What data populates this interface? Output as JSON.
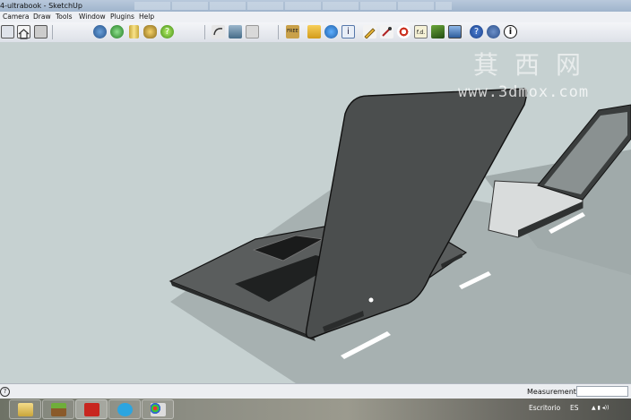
{
  "window": {
    "title": "4-ultrabook - SketchUp"
  },
  "menu": [
    {
      "label": "Camera"
    },
    {
      "label": "Draw"
    },
    {
      "label": "Tools"
    },
    {
      "label": "Window"
    },
    {
      "label": "Plugins"
    },
    {
      "label": "Help"
    }
  ],
  "toolbar": {
    "icons": [
      "view-iso-icon",
      "view-top-icon",
      "view-front-icon",
      "orbit-icon",
      "globe-icon",
      "cylinder-icon",
      "walk-icon",
      "green-help-icon",
      "undo-icon",
      "paint-roller-icon",
      "eraser-icon",
      "sketchup-free-icon",
      "folder-icon",
      "earth-icon",
      "info-icon",
      "pencil-icon",
      "eyedropper-icon",
      "target-icon",
      "fd-icon",
      "fern-icon",
      "monitor-icon",
      "help-question-icon",
      "camera-icon",
      "info-circle-icon"
    ],
    "fd_label": "f.d.",
    "free_label": "FREE"
  },
  "watermark": {
    "url": "www.3dmox.com",
    "chinese": "萁西网"
  },
  "statusbar": {
    "help": "?",
    "measurements_label": "Measurements",
    "measurements_value": ""
  },
  "taskbar": {
    "apps": [
      "file-explorer-icon",
      "minecraft-icon",
      "sketchup-icon",
      "skype-icon",
      "paint-icon"
    ],
    "desktop_label": "Escritorio",
    "language": "ES",
    "colors": {
      "accent": "#1f4f8f",
      "sketchup": "#c8261f",
      "skype": "#2ca5e0"
    }
  }
}
